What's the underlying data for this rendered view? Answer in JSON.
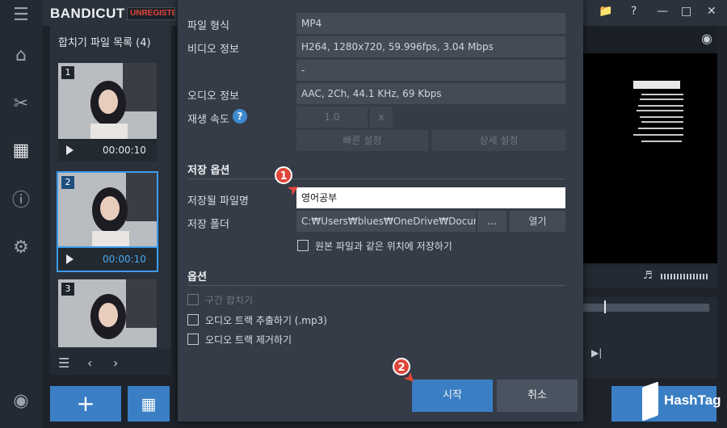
{
  "app": {
    "logo": "BANDICUT",
    "badge": "UNREGISTERED"
  },
  "list": {
    "title": "합치기 파일 목록 (4)",
    "items": [
      {
        "num": "1",
        "time": "00:00:10"
      },
      {
        "num": "2",
        "time": "00:00:10"
      },
      {
        "num": "3",
        "time": ""
      }
    ]
  },
  "dialog": {
    "file_format_label": "파일 형식",
    "file_format_value": "MP4",
    "video_info_label": "비디오 정보",
    "video_info_value": "H264, 1280x720, 59.996fps, 3.04 Mbps",
    "extra_value": "-",
    "audio_info_label": "오디오 정보",
    "audio_info_value": "AAC, 2Ch, 44.1 KHz, 69 Kbps",
    "speed_label": "재생 속도",
    "speed_value": "1.0",
    "speed_unit": "x",
    "quick_setting": "빠른 설정",
    "detail_setting": "상세 설정",
    "save_section": "저장 옵션",
    "filename_label": "저장될 파일명",
    "filename_value": "영어공부",
    "folder_label": "저장 폴더",
    "folder_value": "C:₩Users₩blues₩OneDrive₩Document",
    "browse_button": "...",
    "open_button": "열기",
    "same_location_label": "원본 파일과 같은 위치에 저장하기",
    "options_section": "옵션",
    "section_merge_label": "구간 합치기",
    "extract_audio_label": "오디오 트랙 추출하기 (.mp3)",
    "remove_audio_label": "오디오 트랙 제거하기",
    "start_button": "시작",
    "cancel_button": "취소"
  },
  "markers": {
    "one": "1",
    "two": "2"
  },
  "watermark": "HashTag",
  "colors": {
    "accent": "#3a7fc4",
    "marker": "#e0463a",
    "dialog_bg": "#353c47"
  }
}
